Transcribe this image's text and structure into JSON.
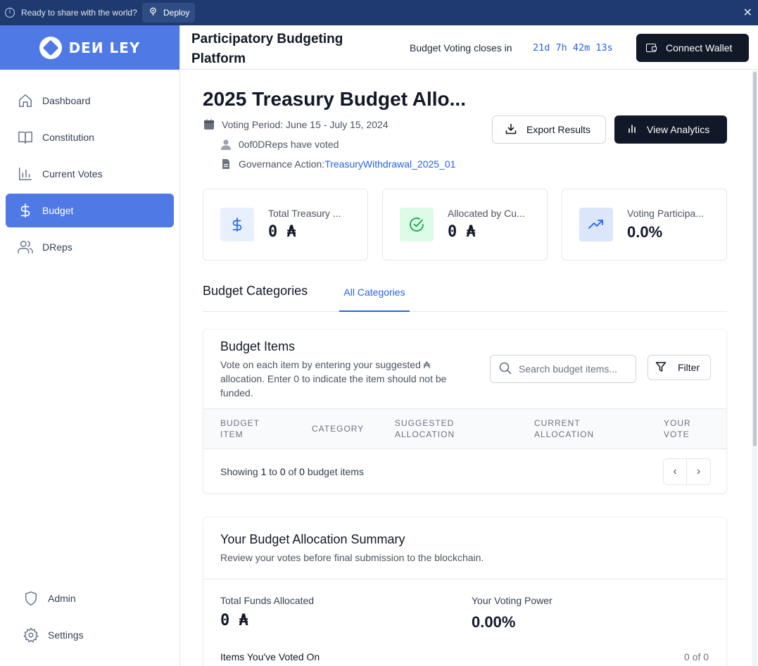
{
  "banner": {
    "message": "Ready to share with the world?",
    "deploy_label": "Deploy",
    "info_icon": "i",
    "close_icon": "✕"
  },
  "brand": {
    "logo_text": "DEИ LEY"
  },
  "sidebar": {
    "items": [
      {
        "label": "Dashboard",
        "icon": "home-icon"
      },
      {
        "label": "Constitution",
        "icon": "book-icon"
      },
      {
        "label": "Current Votes",
        "icon": "bar-chart-icon"
      },
      {
        "label": "Budget",
        "icon": "dollar-icon",
        "active": true
      },
      {
        "label": "DReps",
        "icon": "users-icon"
      }
    ],
    "bottom": [
      {
        "label": "Admin",
        "icon": "shield-icon"
      },
      {
        "label": "Settings",
        "icon": "gear-icon"
      }
    ]
  },
  "header": {
    "title": "Participatory Budgeting Platform",
    "closes_label": "Budget Voting closes in",
    "countdown": "21d 7h 42m 13s",
    "wallet_label": "Connect Wallet"
  },
  "page": {
    "title": "2025 Treasury Budget Allo...",
    "voting_period": "Voting Period: June 15 - July 15, 2024",
    "dreps_voted": "0of0DReps have voted",
    "gov_action_label": "Governance Action:",
    "gov_action_link": "TreasuryWithdrawal_2025_01",
    "export_label": "Export Results",
    "analytics_label": "View Analytics"
  },
  "stats": [
    {
      "label": "Total Treasury ...",
      "value": "0 ₳",
      "icon": "dollar-icon",
      "color": "#e8f0fe"
    },
    {
      "label": "Allocated by Cu...",
      "value": "0 ₳",
      "icon": "check-circle-icon",
      "color": "#dcfce7"
    },
    {
      "label": "Voting Participa...",
      "value": "0.0%",
      "icon": "trending-up-icon",
      "color": "#dbe6fb"
    }
  ],
  "tabs": {
    "section_label": "Budget Categories",
    "active_tab": "All Categories"
  },
  "budget_items": {
    "title": "Budget Items",
    "description": "Vote on each item by entering your suggested ₳ allocation. Enter 0 to indicate the item should not be funded.",
    "search_placeholder": "Search budget items...",
    "filter_label": "Filter",
    "columns": [
      "BUDGET ITEM",
      "CATEGORY",
      "SUGGESTED ALLOCATION",
      "CURRENT ALLOCATION",
      "YOUR VOTE"
    ],
    "showing_prefix": "Showing",
    "showing_from": "1",
    "showing_to_word": "to",
    "showing_to": "0",
    "showing_of_word": "of",
    "showing_total": "0",
    "showing_suffix": "budget items",
    "prev": "‹",
    "next": "›"
  },
  "summary": {
    "title": "Your Budget Allocation Summary",
    "description": "Review your votes before final submission to the blockchain.",
    "funds_label": "Total Funds Allocated",
    "funds_value": "0 ₳",
    "power_label": "Your Voting Power",
    "power_value": "0.00%",
    "items_label": "Items You've Voted On",
    "items_value": "0 of 0"
  }
}
